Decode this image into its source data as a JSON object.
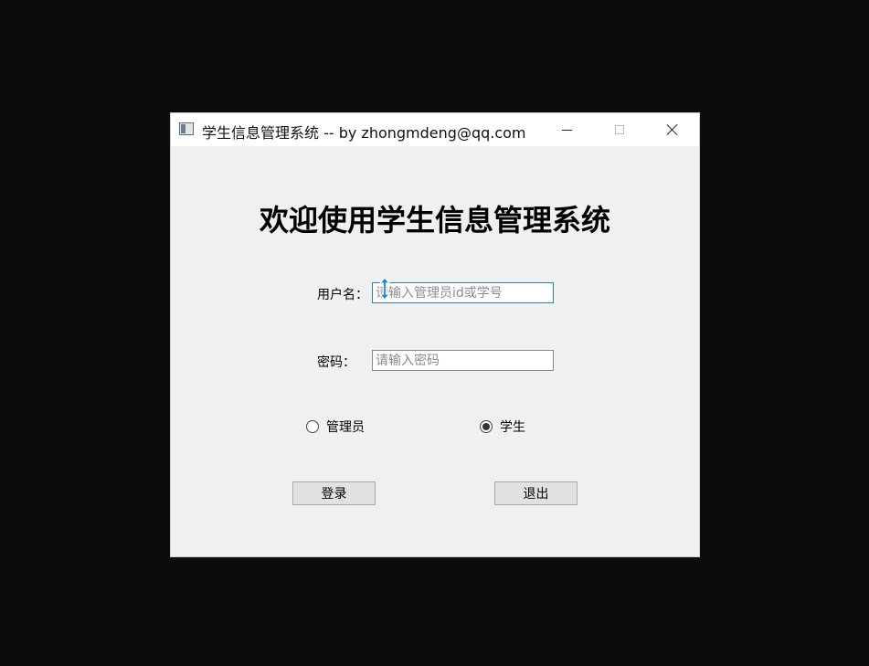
{
  "window": {
    "title": "学生信息管理系统 -- by zhongmdeng@qq.com"
  },
  "main": {
    "welcome": "欢迎使用学生信息管理系统",
    "username_label": "用户名：",
    "username_placeholder": "请输入管理员id或学号",
    "password_label": "密码：",
    "password_placeholder": "请输入密码",
    "roles": [
      {
        "label": "管理员",
        "checked": false
      },
      {
        "label": "学生",
        "checked": true
      }
    ],
    "login_label": "登录",
    "exit_label": "退出"
  },
  "colors": {
    "window_bg": "#eff0f1",
    "focus_border": "#2d7fb8",
    "cursor": "#1e88d8"
  },
  "icons": {
    "app": "app-window-icon",
    "minimize": "minimize-icon",
    "maximize": "maximize-icon",
    "close": "close-icon",
    "cursor": "resize-vertical-cursor-icon"
  }
}
